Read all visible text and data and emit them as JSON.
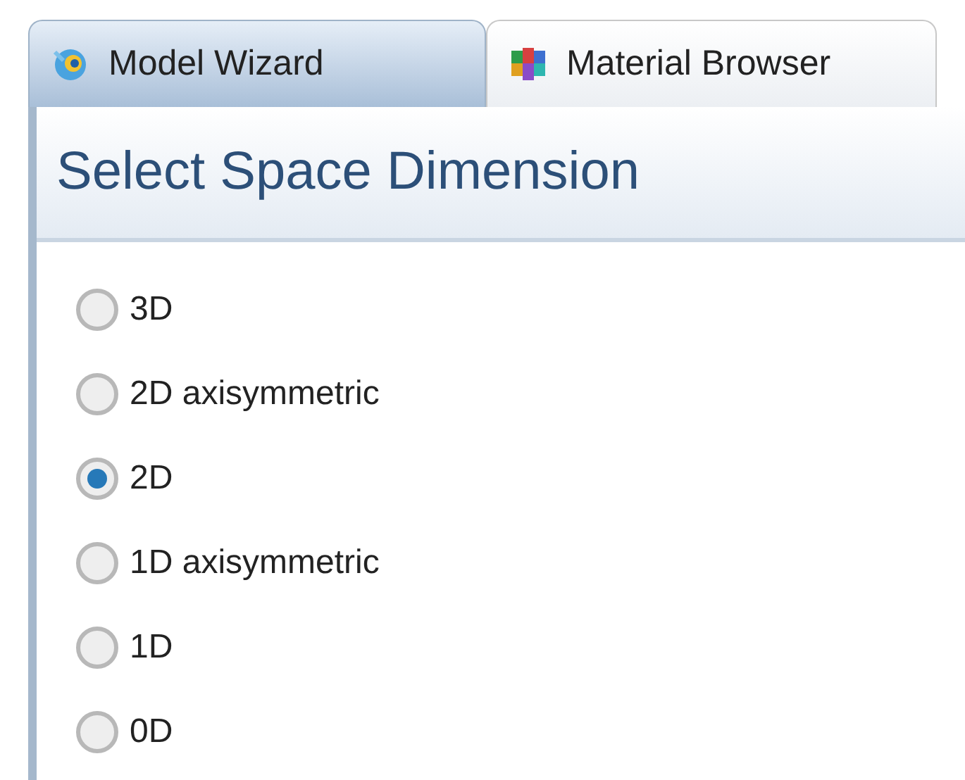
{
  "tabs": [
    {
      "label": "Model Wizard",
      "selected": true,
      "kind": "wizard"
    },
    {
      "label": "Material Browser",
      "selected": false,
      "kind": "materials"
    }
  ],
  "heading": "Select Space Dimension",
  "options": [
    {
      "label": "3D",
      "selected": false
    },
    {
      "label": "2D axisymmetric",
      "selected": false
    },
    {
      "label": "2D",
      "selected": true
    },
    {
      "label": "1D axisymmetric",
      "selected": false
    },
    {
      "label": "1D",
      "selected": false
    },
    {
      "label": "0D",
      "selected": false
    }
  ]
}
